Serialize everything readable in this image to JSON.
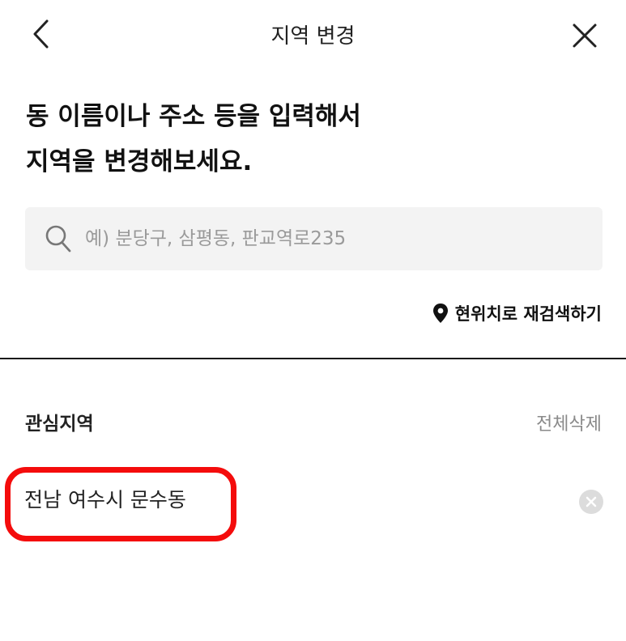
{
  "header": {
    "title": "지역 변경",
    "back_icon": "chevron-left-icon",
    "close_icon": "close-icon"
  },
  "heading": {
    "line1": "동 이름이나 주소 등을 입력해서",
    "line2": "지역을 변경해보세요."
  },
  "search": {
    "value": "",
    "placeholder": "예) 분당구, 삼평동, 판교역로235",
    "icon": "search-icon"
  },
  "relocate": {
    "icon": "map-pin-icon",
    "label": "현위치로 재검색하기"
  },
  "favorites": {
    "title": "관심지역",
    "clear_all_label": "전체삭제",
    "items": [
      {
        "label": "전남 여수시 문수동",
        "remove_icon": "remove-circle-icon"
      }
    ]
  },
  "annotation": {
    "color": "#f40c0c"
  }
}
